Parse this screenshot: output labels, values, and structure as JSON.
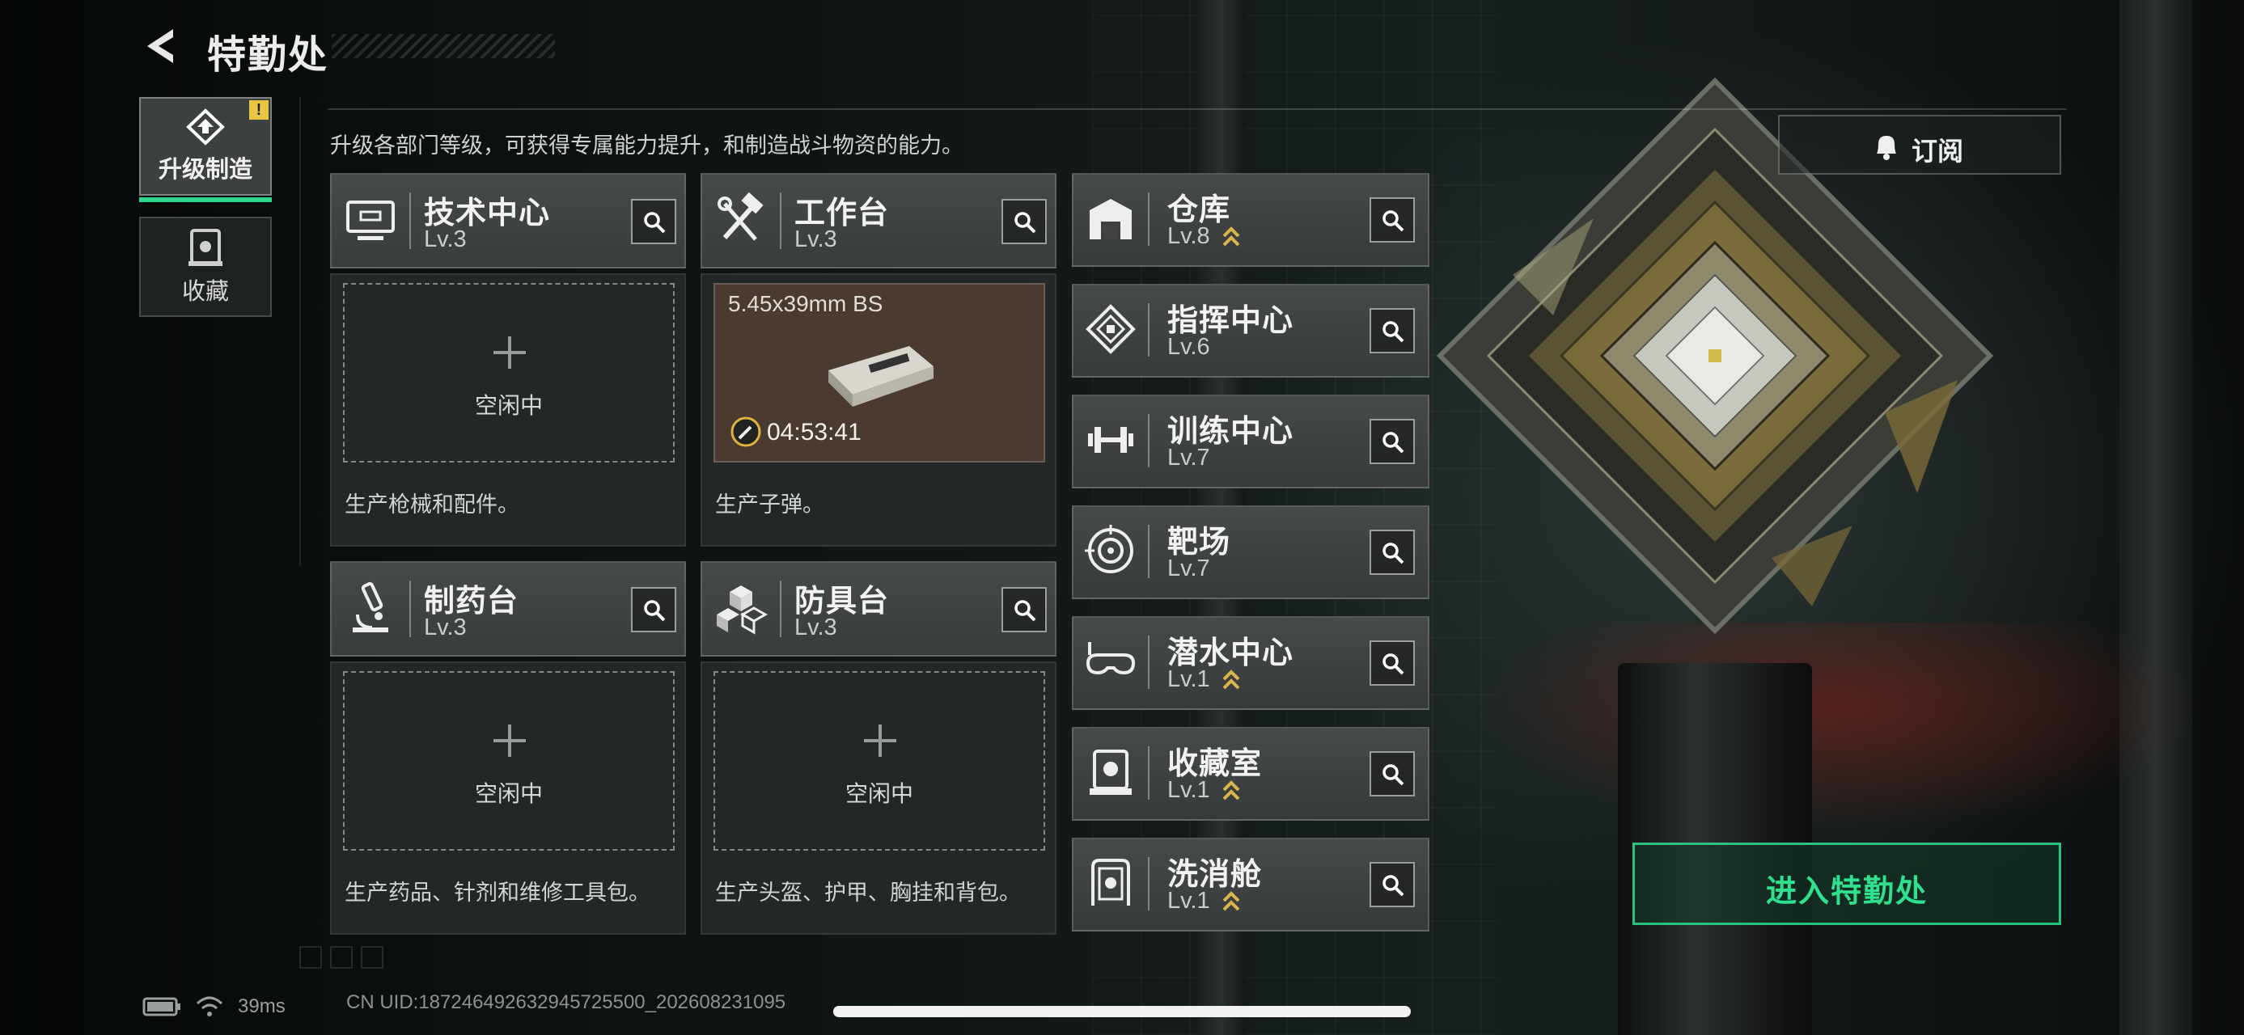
{
  "header": {
    "title": "特勤处",
    "subtitle": "升级各部门等级，可获得专属能力提升，和制造战斗物资的能力。"
  },
  "sidebar": {
    "tabs": [
      {
        "label": "升级制造",
        "active": true,
        "badge": "!"
      },
      {
        "label": "收藏",
        "active": false
      }
    ]
  },
  "workbenches": [
    {
      "name": "技术中心",
      "level": "Lv.3",
      "slot_state": "空闲中",
      "description": "生产枪械和配件。"
    },
    {
      "name": "工作台",
      "level": "Lv.3",
      "production": {
        "item": "5.45x39mm BS",
        "timer": "04:53:41"
      },
      "description": "生产子弹。"
    },
    {
      "name": "制药台",
      "level": "Lv.3",
      "slot_state": "空闲中",
      "description": "生产药品、针剂和维修工具包。"
    },
    {
      "name": "防具台",
      "level": "Lv.3",
      "slot_state": "空闲中",
      "description": "生产头盔、护甲、胸挂和背包。"
    }
  ],
  "facilities": [
    {
      "name": "仓库",
      "level": "Lv.8",
      "upgradable": true,
      "icon": "warehouse-icon"
    },
    {
      "name": "指挥中心",
      "level": "Lv.6",
      "upgradable": false,
      "icon": "command-center-icon"
    },
    {
      "name": "训练中心",
      "level": "Lv.7",
      "upgradable": false,
      "icon": "dumbbell-icon"
    },
    {
      "name": "靶场",
      "level": "Lv.7",
      "upgradable": false,
      "icon": "target-icon"
    },
    {
      "name": "潜水中心",
      "level": "Lv.1",
      "upgradable": true,
      "icon": "diving-goggles-icon"
    },
    {
      "name": "收藏室",
      "level": "Lv.1",
      "upgradable": true,
      "icon": "collection-room-icon"
    },
    {
      "name": "洗消舱",
      "level": "Lv.1",
      "upgradable": true,
      "icon": "decon-chamber-icon"
    }
  ],
  "buttons": {
    "subscribe": "订阅",
    "enter": "进入特勤处"
  },
  "status": {
    "ping": "39ms",
    "uid": "CN UID:18724649263294572550​0_202608231095"
  },
  "colors": {
    "accent_green": "#2fe08f",
    "badge_yellow": "#e8c544",
    "upgrade_arrow": "#d9b54a"
  }
}
